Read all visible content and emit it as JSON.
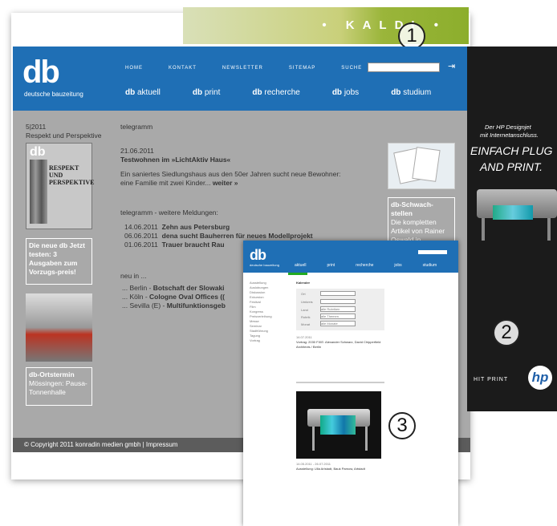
{
  "banner": {
    "text": "• KALDI •"
  },
  "badges": {
    "one": "1",
    "two": "2",
    "three": "3"
  },
  "header": {
    "logo": "db",
    "logo_sub": "deutsche bauzeitung",
    "topnav": [
      "HOME",
      "KONTAKT",
      "NEWSLETTER",
      "SITEMAP",
      "SUCHE"
    ],
    "mainnav": [
      {
        "prefix": "db",
        "label": "aktuell"
      },
      {
        "prefix": "db",
        "label": "print"
      },
      {
        "prefix": "db",
        "label": "recherche"
      },
      {
        "prefix": "db",
        "label": "jobs"
      },
      {
        "prefix": "db",
        "label": "studium"
      }
    ]
  },
  "left": {
    "issue": "5|2011",
    "issue_title": "Respekt und Perspektive",
    "cover_text": "RESPEKT UND PERSPEKTIVE",
    "promo": "Die neue db Jetzt testen: 3 Ausgaben zum Vorzugs-preis!",
    "ortstermin_title": "db-Ortstermin",
    "ortstermin_text": "Mössingen: Pausa-Tonnenhalle"
  },
  "center": {
    "section": "telegramm",
    "date": "21.06.2011",
    "headline": "Testwohnen im »LichtAktiv Haus«",
    "teaser": "Ein saniertes Siedlungshaus aus den 50er Jahren sucht neue Bewohner: eine Familie mit zwei Kinder...",
    "more": "weiter »",
    "more_title": "telegramm - weitere Meldungen:",
    "items": [
      {
        "date": "14.06.2011",
        "title": "Zehn aus Petersburg"
      },
      {
        "date": "06.06.2011",
        "title": "dena sucht Bauherren für neues Modellprojekt"
      },
      {
        "date": "01.06.2011",
        "title": "Trauer braucht Rau"
      }
    ],
    "new_title": "neu in ...",
    "new_items": [
      {
        "place": "... Berlin - ",
        "title": "Botschaft der Slowaki"
      },
      {
        "place": "... Köln - ",
        "title": "Cologne Oval Offices (("
      },
      {
        "place": "... Sevilla (E) - ",
        "title": "Multifunktionsgeb"
      }
    ]
  },
  "right": {
    "title": "db-Schwach-stellen",
    "text": "Die kompletten Artikel von Rainer Oswald in"
  },
  "footer": {
    "text": "© Copyright 2011 konradin medien gmbh | Impressum"
  },
  "hp_ad": {
    "line1": "Der HP Designjet",
    "line2": "mit Internetanschluss.",
    "headline1": "EINFACH PLUG",
    "headline2": "AND PRINT.",
    "tagline": "HIT PRINT",
    "brand": "hp"
  },
  "overlay": {
    "logo": "db",
    "logo_sub": "deutsche bauzeitung",
    "nav": [
      "aktuell",
      "print",
      "recherche",
      "jobs",
      "studium"
    ],
    "sidebar": [
      "Ausstellung",
      "Auslobungen",
      "Diskussion",
      "Exkursion",
      "Festival",
      "Film",
      "Kongress",
      "Preisverleihung",
      "Messe",
      "Seminar",
      "Stadtführung",
      "Tagung",
      "Vortrag"
    ],
    "form_title": "Kalender",
    "form_labels": [
      "Ort",
      "Umkreis",
      "Land",
      "Rubrik",
      "Monat"
    ],
    "select_values": [
      "alle Rubriken",
      "alle Themen",
      "alle Monate"
    ],
    "event1_date": "14.07.2011",
    "event1_title": "Vortrag: 2030 FIXE: Alexander Schwarz, David Chipperfield Architects / Berlin",
    "event2_date": "14.05.2011 - 26.07.2011",
    "event2_title": "Ausstellung: Ulla Arlstadt, Bauk Parnow, Artstadt"
  }
}
